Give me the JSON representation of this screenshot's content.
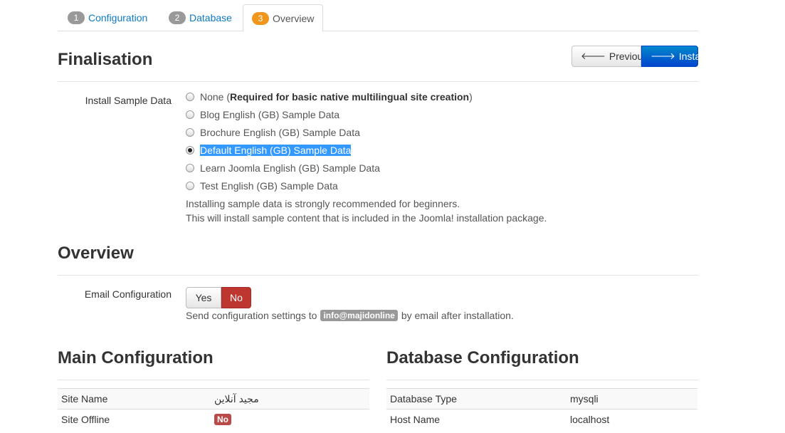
{
  "tabs": [
    {
      "num": "1",
      "label": "Configuration"
    },
    {
      "num": "2",
      "label": "Database"
    },
    {
      "num": "3",
      "label": "Overview"
    }
  ],
  "finalisation": {
    "title": "Finalisation",
    "previous_label": "Previous",
    "install_label": "Install",
    "sample_data_label": "Install Sample Data",
    "options": [
      {
        "label": "None (",
        "bold": "Required for basic native multilingual site creation",
        "suffix": ")"
      },
      {
        "label": "Blog English (GB) Sample Data"
      },
      {
        "label": "Brochure English (GB) Sample Data"
      },
      {
        "label": "Default English (GB) Sample Data"
      },
      {
        "label": "Learn Joomla English (GB) Sample Data"
      },
      {
        "label": "Test English (GB) Sample Data"
      }
    ],
    "help_1": "Installing sample data is strongly recommended for beginners.",
    "help_2": "This will install sample content that is included in the Joomla! installation package."
  },
  "overview": {
    "title": "Overview",
    "email_label": "Email Configuration",
    "yes_label": "Yes",
    "no_label": "No",
    "send_prefix": "Send configuration settings to",
    "email_badge": "info@majidonline",
    "send_suffix": "by email after installation."
  },
  "main_config": {
    "title": "Main Configuration",
    "rows": [
      {
        "key": "Site Name",
        "value": "مجید آنلاین"
      },
      {
        "key": "Site Offline",
        "badge": "No"
      }
    ]
  },
  "db_config": {
    "title": "Database Configuration",
    "rows": [
      {
        "key": "Database Type",
        "value": "mysqli"
      },
      {
        "key": "Host Name",
        "value": "localhost"
      }
    ]
  }
}
